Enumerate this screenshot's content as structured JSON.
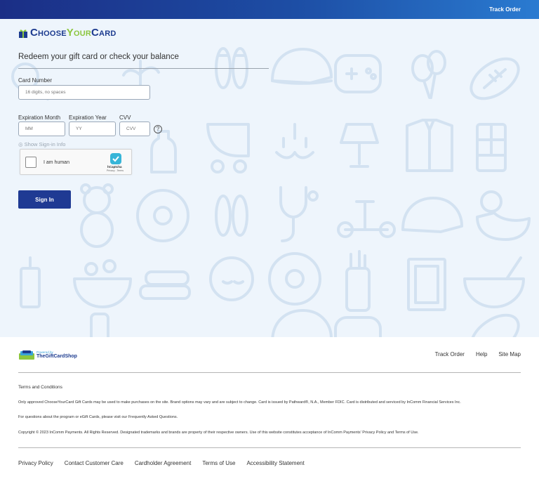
{
  "header": {
    "track_order": "Track Order"
  },
  "brand": {
    "part1": "Choose",
    "part2": "Your",
    "part3": "Card",
    "colors": {
      "navy": "#1c3b8f",
      "green": "#8cc63f"
    }
  },
  "form": {
    "headline": "Redeem your gift card or check your balance",
    "card_number_label": "Card Number",
    "card_number_placeholder": "16 digits, no spaces",
    "exp_month_label": "Expiration Month",
    "exp_month_placeholder": "MM",
    "exp_year_label": "Expiration Year",
    "exp_year_placeholder": "YY",
    "cvv_label": "CVV",
    "cvv_placeholder": "CVV",
    "help_glyph": "?",
    "show_signin_info": "Show Sign-in Info",
    "captcha_label": "I am human",
    "captcha_brand": "hCaptcha",
    "captcha_sub": "Privacy - Terms",
    "sign_in": "Sign In",
    "accent": "#1f3a93"
  },
  "footer": {
    "powered_by": "Powered by",
    "shop_name": "TheGiftCardShop",
    "links": [
      "Track Order",
      "Help",
      "Site Map"
    ],
    "terms_title": "Terms and Conditions",
    "terms_text": "Only approved ChooseYourCard Gift Cards may be used to make purchases on the site. Brand options may vary and are subject to change. Card is issued by Pathward®, N.A., Member FDIC. Card is distributed and serviced by InComm Financial Services Inc.",
    "faq_text": "For questions about the program or eGift Cards, please visit our Frequently Asked Questions.",
    "copyright": "Copyright © 2023 InComm Payments. All Rights Reserved. Designated trademarks and brands are property of their respective owners. Use of this website constitutes acceptance of InComm Payments' Privacy Policy and Terms of Use.",
    "bottom_links": [
      "Privacy Policy",
      "Contact Customer Care",
      "Cardholder Agreement",
      "Terms of Use",
      "Accessibility Statement"
    ]
  }
}
